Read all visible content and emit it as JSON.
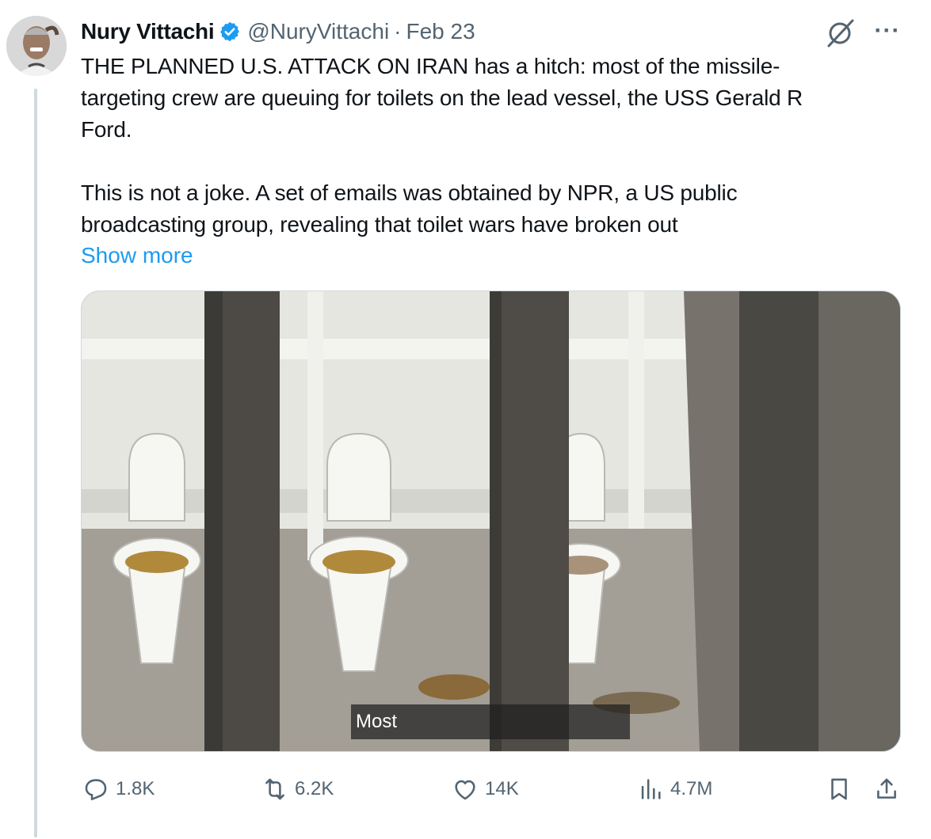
{
  "tweet": {
    "author_name": "Nury Vittachi",
    "handle": "@NuryVittachi",
    "separator": "·",
    "date": "Feb 23",
    "text": "THE PLANNED U.S. ATTACK ON IRAN has a hitch: most of the missile-\ntargeting crew are queuing for toilets on the lead vessel, the USS Gerald R\nFord.\n\nThis is not a joke. A set of emails was obtained by NPR, a US public\nbroadcasting group, revealing that toilet wars have broken out",
    "show_more_label": "Show more",
    "more_label": "···"
  },
  "media": {
    "caption": "Most"
  },
  "actions": {
    "replies": "1.8K",
    "reposts": "6.2K",
    "likes": "14K",
    "views": "4.7M"
  },
  "icons": {
    "verified": "verified-badge-icon",
    "grok": "grok-icon",
    "more": "more-icon",
    "reply": "reply-icon",
    "retweet": "retweet-icon",
    "like": "heart-icon",
    "views": "views-icon",
    "bookmark": "bookmark-icon",
    "share": "share-icon"
  },
  "colors": {
    "accent": "#1d9bf0",
    "secondary_text": "#536471",
    "border": "#cfd9de"
  }
}
